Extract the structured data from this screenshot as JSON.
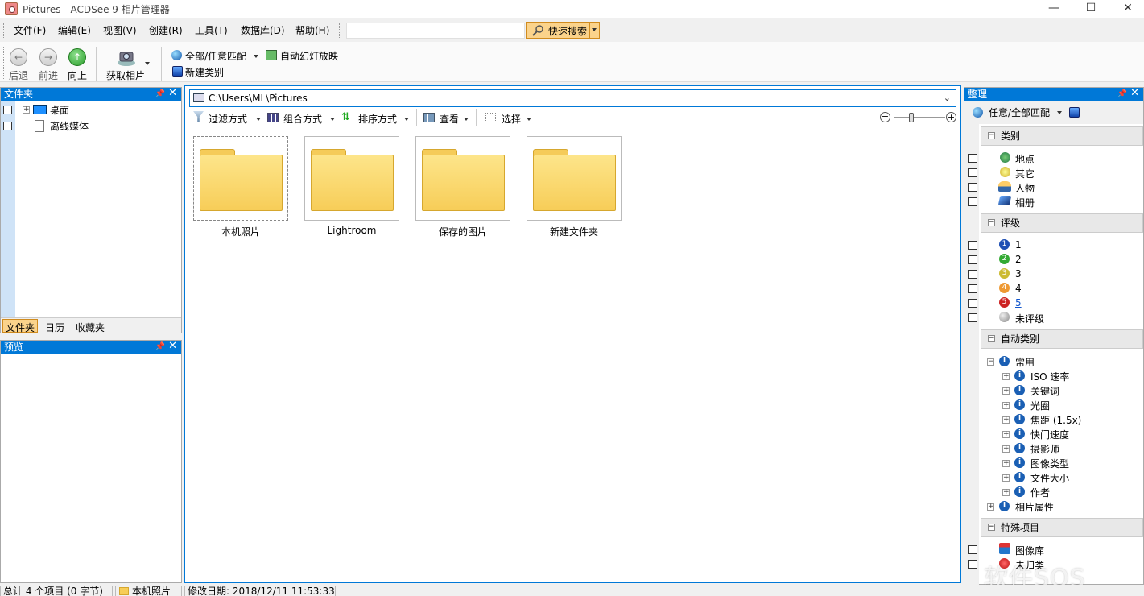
{
  "window": {
    "title": "Pictures - ACDSee 9 相片管理器",
    "minimize": "—",
    "maximize": "☐",
    "close": "✕"
  },
  "menu": [
    "文件(F)",
    "编辑(E)",
    "视图(V)",
    "创建(R)",
    "工具(T)",
    "数据库(D)",
    "帮助(H)"
  ],
  "search": {
    "value": "",
    "button_label": "快速搜索"
  },
  "toolbar": {
    "back": "后退",
    "forward": "前进",
    "up": "向上",
    "get_photos": "获取相片",
    "match_all": "全部/任意匹配",
    "auto_slideshow": "自动幻灯放映",
    "new_category": "新建类别"
  },
  "folders_pane": {
    "title": "文件夹",
    "tree": [
      "桌面",
      "离线媒体"
    ],
    "tabs": [
      "文件夹",
      "日历",
      "收藏夹"
    ]
  },
  "preview_pane": {
    "title": "预览"
  },
  "browser": {
    "path": "C:\\Users\\ML\\Pictures",
    "tools": [
      "过滤方式",
      "组合方式",
      "排序方式",
      "查看",
      "选择"
    ],
    "items": [
      "本机照片",
      "Lightroom",
      "保存的图片",
      "新建文件夹"
    ]
  },
  "organize": {
    "title": "整理",
    "match": "任意/全部匹配",
    "categories_header": "类别",
    "categories": [
      "地点",
      "其它",
      "人物",
      "相册"
    ],
    "ratings_header": "评级",
    "ratings": [
      "1",
      "2",
      "3",
      "4",
      "5",
      "未评级"
    ],
    "auto_header": "自动类别",
    "auto_common": "常用",
    "auto_items": [
      "ISO 速率",
      "关键词",
      "光圈",
      "焦距 (1.5x)",
      "快门速度",
      "摄影师",
      "图像类型",
      "文件大小",
      "作者"
    ],
    "photo_props": "相片属性",
    "special_header": "特殊项目",
    "special": [
      "图像库",
      "未归类"
    ]
  },
  "status": {
    "total": "总计 4 个项目 (0 字节)",
    "current": "本机照片",
    "modified": "修改日期: 2018/12/11 11:53:33"
  },
  "watermark": "软件SOS",
  "colors": {
    "accent": "#0078d7",
    "search_btn": "#fbd38b"
  }
}
